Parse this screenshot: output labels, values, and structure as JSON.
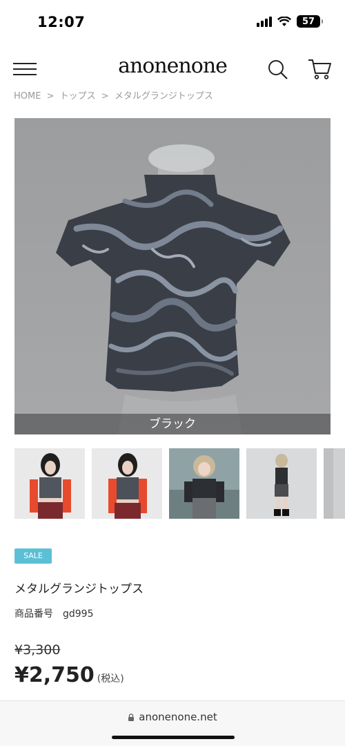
{
  "status_bar": {
    "time": "12:07",
    "battery": "57"
  },
  "header": {
    "logo": "anonenone"
  },
  "breadcrumb": [
    "HOME",
    ">",
    "トップス",
    ">",
    "メタルグランジトップス"
  ],
  "main_image": {
    "color_label": "ブラック"
  },
  "product": {
    "badge": "SALE",
    "name": "メタルグランジトップス",
    "code_label": "商品番号",
    "code_value": "gd995",
    "old_price": "¥3,300",
    "price": "¥2,750",
    "tax_note": "(税込)"
  },
  "browser": {
    "url": "anonenone.net"
  },
  "colors": {
    "sale": "#5bc0d6",
    "background": "#ffffff",
    "text": "#222222"
  }
}
